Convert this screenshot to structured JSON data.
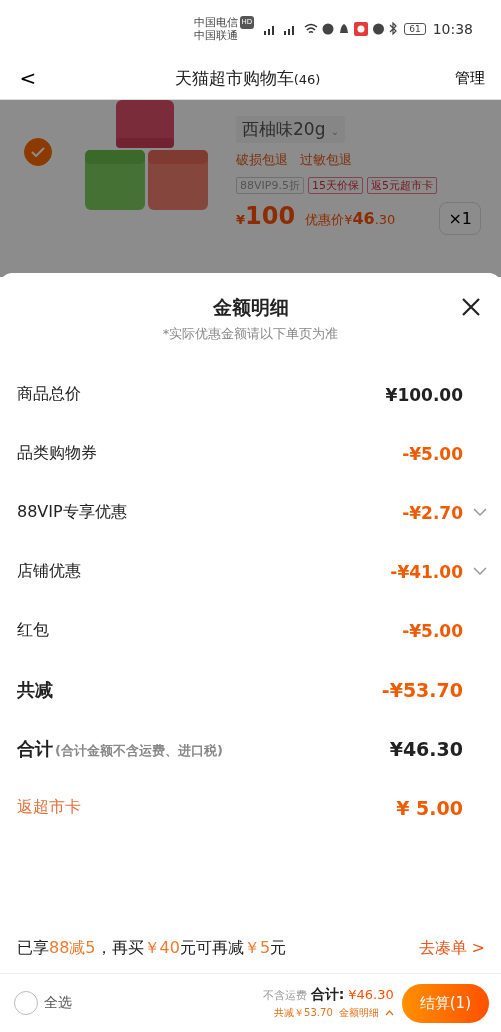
{
  "status_bar": {
    "carrier_1": "中国电信",
    "carrier_2": "中国联通",
    "hd": "HD",
    "battery": "61",
    "time": "10:38"
  },
  "nav": {
    "back": "<",
    "title": "天猫超市购物车",
    "count": "(46)",
    "action": "管理"
  },
  "product": {
    "checked": true,
    "kind": "picture",
    "variant": "西柚味20g",
    "variant_caret": "⌄",
    "services": [
      "破损包退",
      "过敏包退"
    ],
    "tags": [
      {
        "label": "88VIP9.5折",
        "kind": "plain"
      },
      {
        "label": "15天价保",
        "kind": "accent"
      },
      {
        "label": "返5元超市卡",
        "kind": "accent"
      }
    ],
    "price_symbol": "¥",
    "price": "100",
    "deal_label": "优惠价¥",
    "deal_main": "46",
    "deal_cents": ".30",
    "quantity": "×1"
  },
  "sheet": {
    "title": "金额明细",
    "subtitle": "*实际优惠金额请以下单页为准",
    "rows": [
      {
        "kind": "plain",
        "label": "商品总价",
        "value": "¥100.00",
        "expandable": false
      },
      {
        "kind": "discount",
        "label": "品类购物券",
        "value": "-¥5.00",
        "expandable": false
      },
      {
        "kind": "discount",
        "label": "88VIP专享优惠",
        "value": "-¥2.70",
        "expandable": true
      },
      {
        "kind": "discount",
        "label": "店铺优惠",
        "value": "-¥41.00",
        "expandable": true
      },
      {
        "kind": "discount",
        "label": "红包",
        "value": "-¥5.00",
        "expandable": false
      },
      {
        "kind": "reduction",
        "label": "共减",
        "value": "-¥53.70",
        "expandable": false
      },
      {
        "kind": "total",
        "label": "合计",
        "note": "(合计金额不含运费、进口税)",
        "value": "¥46.30",
        "expandable": false
      },
      {
        "kind": "rebate",
        "label": "返超市卡",
        "value": "¥ 5.00",
        "expandable": false
      }
    ]
  },
  "promo": {
    "segments": [
      {
        "text": "已享",
        "highlight": false
      },
      {
        "text": "88减5",
        "highlight": true
      },
      {
        "text": "，再买",
        "highlight": false
      },
      {
        "text": "￥40",
        "highlight": true
      },
      {
        "text": "元可再减",
        "highlight": false
      },
      {
        "text": "￥5",
        "highlight": true
      },
      {
        "text": "元",
        "highlight": false
      }
    ],
    "link": "去凑单 >"
  },
  "bottom_bar": {
    "select_all": "全选",
    "select_all_checked": false,
    "shipping_note": "不含运费",
    "total_label": "合计:",
    "total": "¥46.30",
    "reduced": "共减￥53.70",
    "detail_link": "金额明细",
    "checkout": "结算(1)"
  }
}
